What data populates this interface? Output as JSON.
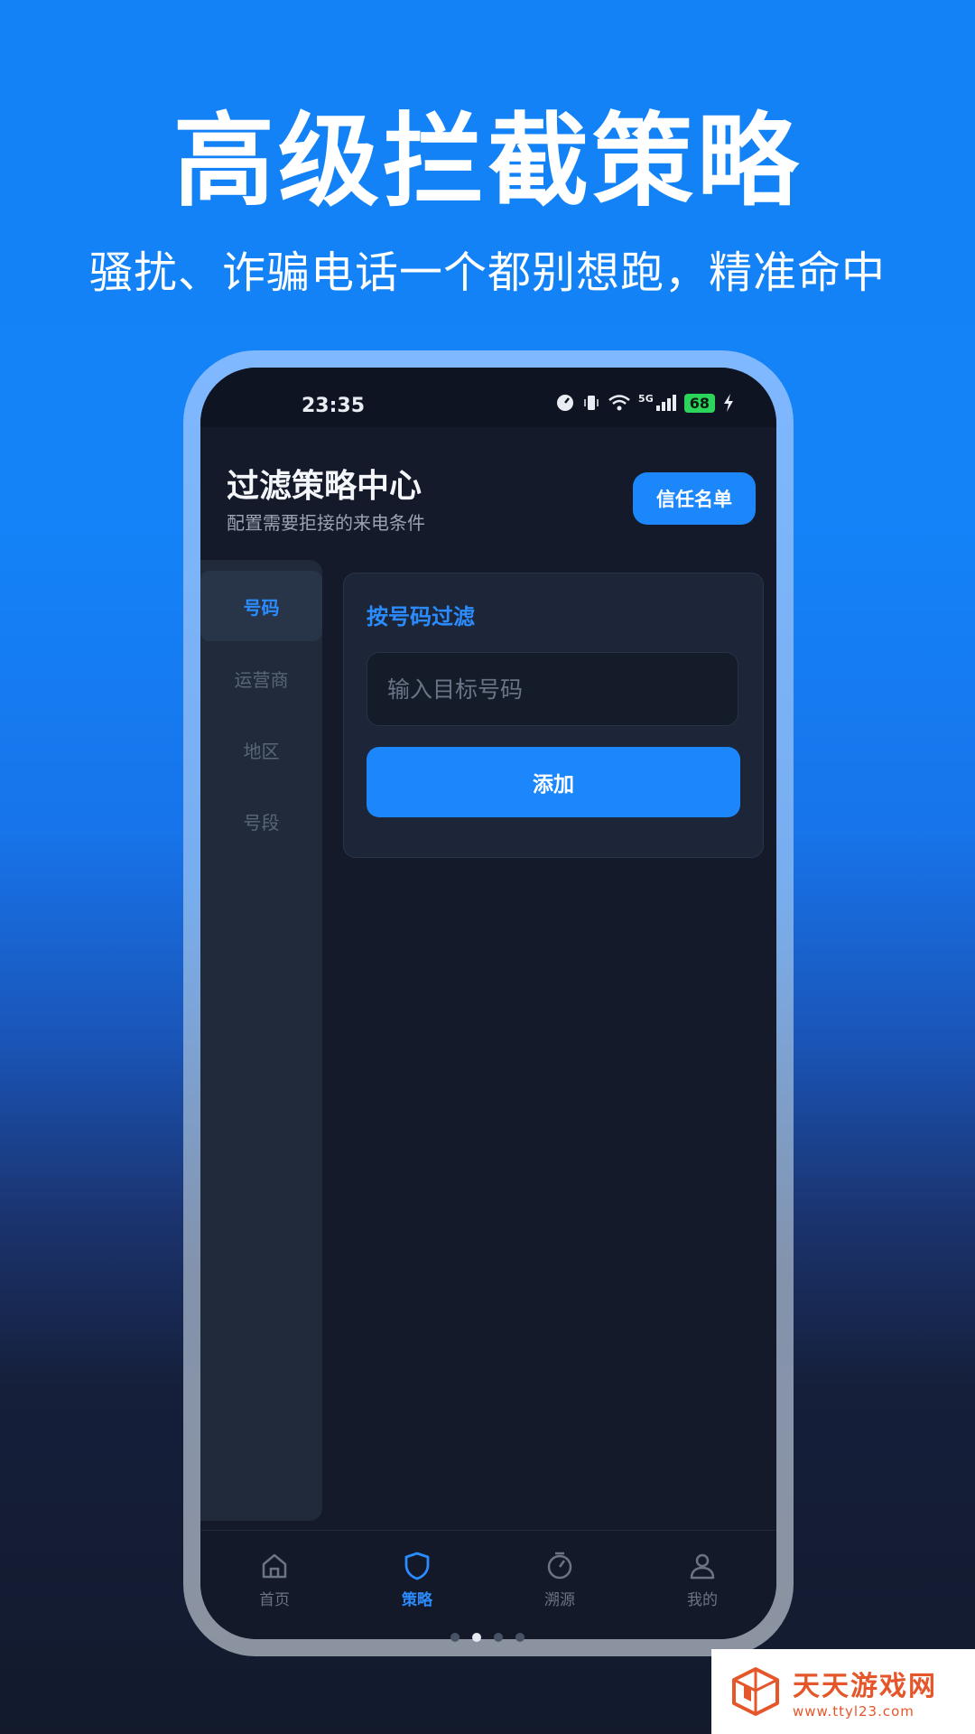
{
  "promo": {
    "title": "高级拦截策略",
    "subtitle": "骚扰、诈骗电话一个都别想跑，精准命中"
  },
  "statusbar": {
    "time": "23:35",
    "network": "5G",
    "battery": "68"
  },
  "header": {
    "title": "过滤策略中心",
    "subtitle": "配置需要拒接的来电条件",
    "trust_button": "信任名单"
  },
  "sidebar": {
    "items": [
      {
        "label": "号码",
        "active": true
      },
      {
        "label": "运营商",
        "active": false
      },
      {
        "label": "地区",
        "active": false
      },
      {
        "label": "号段",
        "active": false
      }
    ]
  },
  "filter_card": {
    "title": "按号码过滤",
    "input_placeholder": "输入目标号码",
    "input_value": "",
    "add_button": "添加"
  },
  "bottom_nav": {
    "items": [
      {
        "label": "首页",
        "icon": "home-icon",
        "active": false
      },
      {
        "label": "策略",
        "icon": "shield-icon",
        "active": true
      },
      {
        "label": "溯源",
        "icon": "timer-icon",
        "active": false
      },
      {
        "label": "我的",
        "icon": "person-icon",
        "active": false
      }
    ]
  },
  "carousel": {
    "active_index": 1,
    "count": 4
  },
  "watermark": {
    "name": "天天游戏网",
    "url": "www.ttyl23.com"
  },
  "colors": {
    "accent": "#1c87fb",
    "background_top": "#1282f5",
    "background_bottom": "#121a2c",
    "screen_bg": "#141a29",
    "watermark": "#e5572a"
  }
}
